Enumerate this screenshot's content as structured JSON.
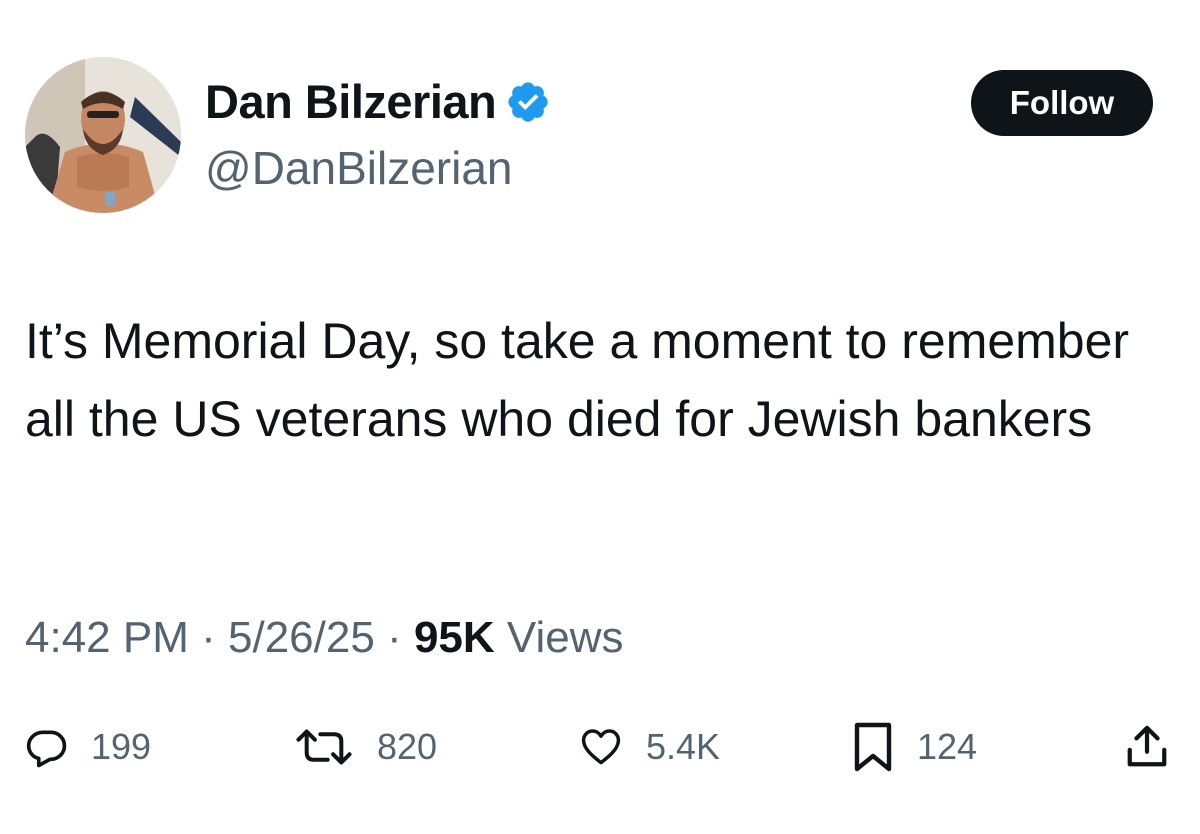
{
  "user": {
    "display_name": "Dan Bilzerian",
    "handle": "@DanBilzerian",
    "verified": true,
    "verified_color": "#1d9bf0"
  },
  "follow_button": {
    "label": "Follow"
  },
  "tweet": {
    "text": "It’s Memorial Day, so take a moment to remember all the US veterans who died for Jewish bankers"
  },
  "meta": {
    "time": "4:42 PM",
    "separator": "·",
    "date": "5/26/25",
    "views_count": "95K",
    "views_label": "Views"
  },
  "actions": {
    "replies": {
      "icon": "reply-icon",
      "count": "199"
    },
    "retweets": {
      "icon": "retweet-icon",
      "count": "820"
    },
    "likes": {
      "icon": "heart-icon",
      "count": "5.4K"
    },
    "bookmarks": {
      "icon": "bookmark-icon",
      "count": "124"
    },
    "share": {
      "icon": "share-icon"
    }
  }
}
